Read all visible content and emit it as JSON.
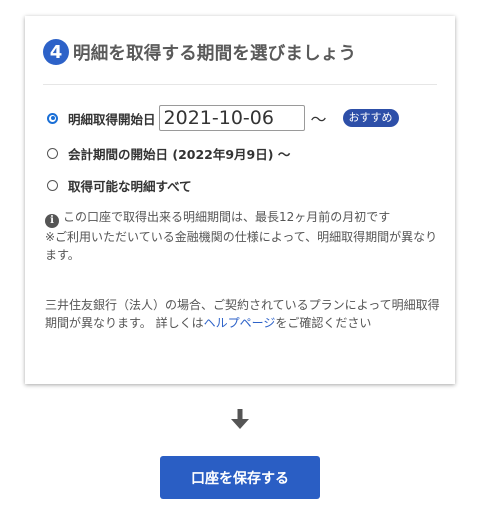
{
  "step": {
    "number": "4",
    "title": "明細を取得する期間を選びましょう"
  },
  "options": [
    {
      "label": "明細取得開始日",
      "checked": true,
      "date_value": "2021-10-06",
      "tilde": "～",
      "badge": "おすすめ"
    },
    {
      "label": "会計期間の開始日 (2022年9月9日) ～",
      "checked": false
    },
    {
      "label": "取得可能な明細すべて",
      "checked": false
    }
  ],
  "notes": {
    "info_icon": "info-icon",
    "line1": "この口座で取得出来る明細期間は、最長12ヶ月前の月初です",
    "line2": "※ご利用いただいている金融機関の仕様によって、明細取得期間が異なります。",
    "bank_note_prefix": "三井住友銀行（法人）の場合、ご契約されているプランによって明細取得期間が異なります。 詳しくは",
    "help_link": "ヘルプページ",
    "bank_note_suffix": "をご確認ください"
  },
  "arrow_icon": "arrow-down-icon",
  "save_button": "口座を保存する",
  "colors": {
    "accent": "#2d62c8",
    "button": "#2a5ec4",
    "badge": "#2d4fa8",
    "radio": "#1a6fd6"
  }
}
